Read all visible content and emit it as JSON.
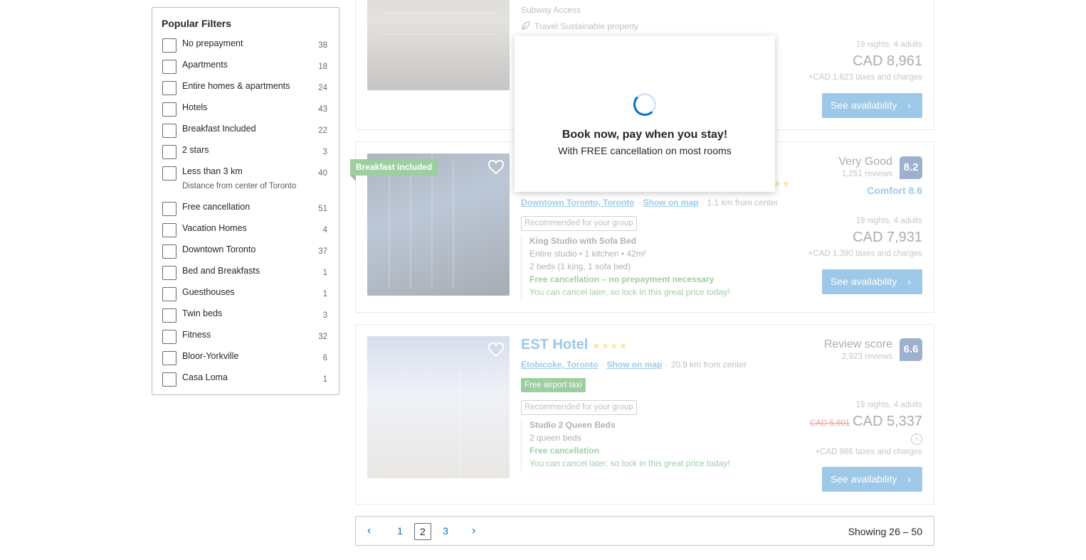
{
  "filters": {
    "title": "Popular Filters",
    "items": [
      {
        "label": "No prepayment",
        "count": "38"
      },
      {
        "label": "Apartments",
        "count": "18"
      },
      {
        "label": "Entire homes & apartments",
        "count": "24"
      },
      {
        "label": "Hotels",
        "count": "43"
      },
      {
        "label": "Breakfast Included",
        "count": "22"
      },
      {
        "label": "2 stars",
        "count": "3"
      },
      {
        "label": "Less than 3 km",
        "count": "40",
        "sub": "Distance from center of Toronto"
      },
      {
        "label": "Free cancellation",
        "count": "51"
      },
      {
        "label": "Vacation Homes",
        "count": "4"
      },
      {
        "label": "Downtown Toronto",
        "count": "37"
      },
      {
        "label": "Bed and Breakfasts",
        "count": "1"
      },
      {
        "label": "Guesthouses",
        "count": "1"
      },
      {
        "label": "Twin beds",
        "count": "3"
      },
      {
        "label": "Fitness",
        "count": "32"
      },
      {
        "label": "Bloor-Yorkville",
        "count": "6"
      },
      {
        "label": "Casa Loma",
        "count": "1"
      }
    ]
  },
  "card1": {
    "amenity": "Subway Access",
    "sustainable": "Travel Sustainable property",
    "nights": "19 nights, 4 adults",
    "price": "CAD 8,961",
    "taxes": "+CAD 1,623 taxes and charges",
    "button": "See availability"
  },
  "card2": {
    "ribbon": "Breakfast included",
    "review_label": "Very Good",
    "review_count": "1,251 reviews",
    "score": "8.2",
    "comfort": "Comfort 8.6",
    "area": "Downtown Toronto, Toronto",
    "show_map": "Show on map",
    "distance": "1.1 km from center",
    "tag": "Recommended for your group",
    "room_name": "King Studio with Sofa Bed",
    "room_desc": "Entire studio • 1 kitchen • 42m²",
    "beds": "2 beds (1 king, 1 sofa bed)",
    "cancel": "Free cancellation – no prepayment necessary",
    "cancel_note": "You can cancel later, so lock in this great price today!",
    "nights": "19 nights, 4 adults",
    "price": "CAD 7,931",
    "taxes": "+CAD 1,390 taxes and charges",
    "button": "See availability"
  },
  "card3": {
    "name": "EST Hotel",
    "stars": "★★★★",
    "review_label": "Review score",
    "review_count": "2,923 reviews",
    "score": "6.6",
    "area": "Etobicoke, Toronto",
    "show_map": "Show on map",
    "distance": "20.9 km from center",
    "pill": "Free airport taxi",
    "tag": "Recommended for your group",
    "room_name": "Studio 2 Queen Beds",
    "beds": "2 queen beds",
    "cancel": "Free cancellation",
    "cancel_note": "You can cancel later, so lock in this great price today!",
    "nights": "19 nights, 4 adults",
    "old_price": "CAD 5,801",
    "price": "CAD 5,337",
    "info": "i",
    "taxes": "+CAD 986 taxes and charges",
    "button": "See availability"
  },
  "pagination": {
    "prev": "‹",
    "pages": [
      "1",
      "2",
      "3"
    ],
    "next": "›",
    "showing": "Showing 26 – 50"
  },
  "popup": {
    "title": "Book now, pay when you stay!",
    "subtitle": "With FREE cancellation on most rooms"
  },
  "icons": {
    "chevron": "›",
    "heart": "heart-icon",
    "leaf": "leaf-icon"
  },
  "colors": {
    "brand_blue": "#0071c2",
    "score_navy": "#003580",
    "green": "#008009",
    "star": "#febb02"
  }
}
